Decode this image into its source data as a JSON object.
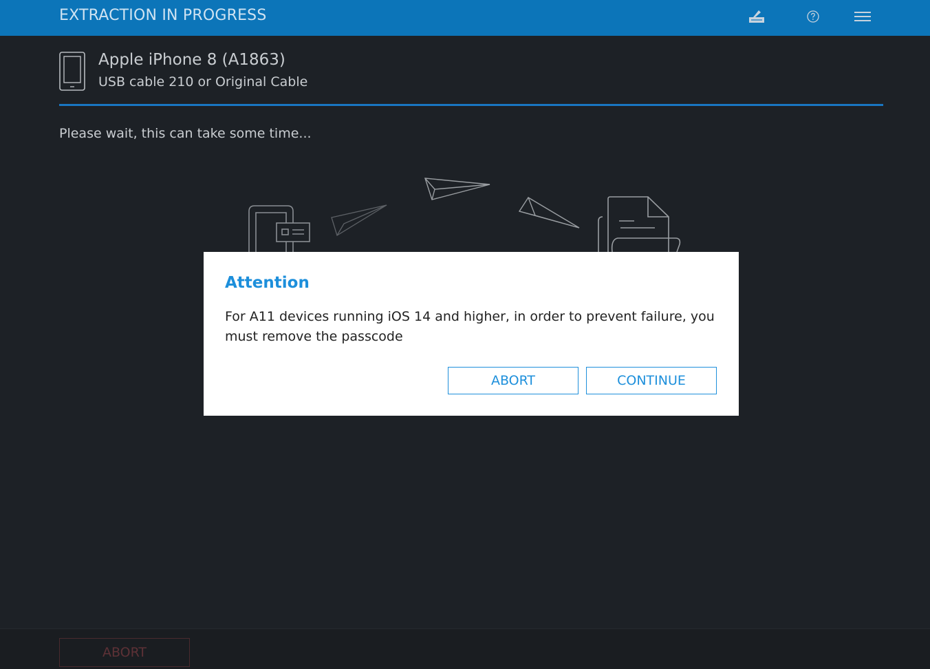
{
  "header": {
    "title": "EXTRACTION IN PROGRESS",
    "icons": [
      "signature-icon",
      "help-icon",
      "menu-icon"
    ]
  },
  "device": {
    "name": "Apple iPhone 8 (A1863)",
    "cable": "USB cable 210 or Original Cable"
  },
  "status": {
    "wait_text": "Please wait, this can take some time..."
  },
  "dialog": {
    "title": "Attention",
    "message": "For A11 devices running iOS 14 and higher, in order to prevent failure, you must remove the passcode",
    "abort_label": "ABORT",
    "continue_label": "CONTINUE"
  },
  "footer": {
    "abort_label": "ABORT"
  },
  "colors": {
    "header_bg": "#0c75b9",
    "body_bg": "#1d2126",
    "accent": "#1d8fdb"
  }
}
